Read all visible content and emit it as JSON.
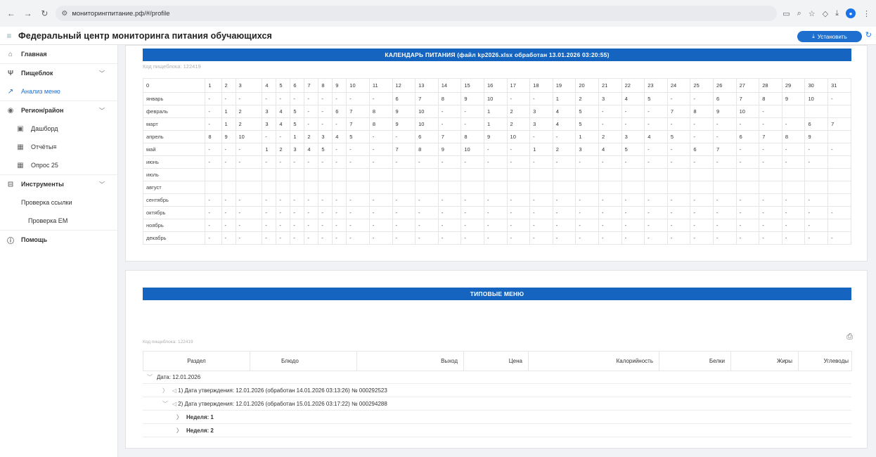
{
  "browser": {
    "url": "мониторингпитание.рф/#/profile"
  },
  "app": {
    "title": "Федеральный центр мониторинга питания обучающихся",
    "install_label": "Установить"
  },
  "sidebar": {
    "items": [
      {
        "label": "Главная",
        "icon": "home-icon"
      },
      {
        "label": "Пищеблок",
        "icon": "fork-knife-icon"
      },
      {
        "label": "Анализ меню",
        "icon": "chart-icon"
      },
      {
        "label": "Регион/район",
        "icon": "eye-icon"
      },
      {
        "label": "Дашборд",
        "icon": "dashboard-icon"
      },
      {
        "label": "Отчёты≡",
        "icon": "table-icon"
      },
      {
        "label": "Опрос 25",
        "icon": "table-icon"
      },
      {
        "label": "Инструменты",
        "icon": "toolbox-icon"
      },
      {
        "label": "Проверка ссылки"
      },
      {
        "label": "Проверка ЕМ"
      },
      {
        "label": "Помощь",
        "icon": "help-icon"
      }
    ]
  },
  "calendar": {
    "title": "КАЛЕНДАРЬ ПИТАНИЯ (файл kp2026.xlsx обработан 13.01.2026 03:20:55)",
    "code_label": "Код пищеблока: 122419",
    "header": [
      "0",
      "1",
      "2",
      "3",
      "4",
      "5",
      "6",
      "7",
      "8",
      "9",
      "10",
      "11",
      "12",
      "13",
      "14",
      "15",
      "16",
      "17",
      "18",
      "19",
      "20",
      "21",
      "22",
      "23",
      "24",
      "25",
      "26",
      "27",
      "28",
      "29",
      "30",
      "31"
    ],
    "rows": [
      [
        "январь",
        "-",
        "-",
        "-",
        "-",
        "-",
        "-",
        "-",
        "-",
        "-",
        "-",
        "-",
        "6",
        "7",
        "8",
        "9",
        "10",
        "-",
        "-",
        "1",
        "2",
        "3",
        "4",
        "5",
        "-",
        "-",
        "6",
        "7",
        "8",
        "9",
        "10",
        "-"
      ],
      [
        "февраль",
        "-",
        "1",
        "2",
        "3",
        "4",
        "5",
        "-",
        "-",
        "6",
        "7",
        "8",
        "9",
        "10",
        "-",
        "-",
        "1",
        "2",
        "3",
        "4",
        "5",
        "-",
        "-",
        "-",
        "7",
        "8",
        "9",
        "10",
        "-",
        "",
        "",
        ""
      ],
      [
        "март",
        "-",
        "1",
        "2",
        "3",
        "4",
        "5",
        "-",
        "-",
        "-",
        "7",
        "8",
        "9",
        "10",
        "-",
        "-",
        "1",
        "2",
        "3",
        "4",
        "5",
        "-",
        "-",
        "-",
        "-",
        "-",
        "-",
        "-",
        "-",
        "-",
        "6",
        "7"
      ],
      [
        "апрель",
        "8",
        "9",
        "10",
        "-",
        "-",
        "1",
        "2",
        "3",
        "4",
        "5",
        "-",
        "-",
        "6",
        "7",
        "8",
        "9",
        "10",
        "-",
        "-",
        "1",
        "2",
        "3",
        "4",
        "5",
        "-",
        "-",
        "6",
        "7",
        "8",
        "9",
        ""
      ],
      [
        "май",
        "-",
        "-",
        "-",
        "1",
        "2",
        "3",
        "4",
        "5",
        "-",
        "-",
        "-",
        "7",
        "8",
        "9",
        "10",
        "-",
        "-",
        "1",
        "2",
        "3",
        "4",
        "5",
        "-",
        "-",
        "6",
        "7",
        "-",
        "-",
        "-",
        "-",
        "-"
      ],
      [
        "июнь",
        "-",
        "-",
        "-",
        "-",
        "-",
        "-",
        "-",
        "-",
        "-",
        "-",
        "-",
        "-",
        "-",
        "-",
        "-",
        "-",
        "-",
        "-",
        "-",
        "-",
        "-",
        "-",
        "-",
        "-",
        "-",
        "-",
        "-",
        "-",
        "-",
        "-",
        ""
      ],
      [
        "июль",
        "",
        "",
        "",
        "",
        "",
        "",
        "",
        "",
        "",
        "",
        "",
        "",
        "",
        "",
        "",
        "",
        "",
        "",
        "",
        "",
        "",
        "",
        "",
        "",
        "",
        "",
        "",
        "",
        "",
        "",
        ""
      ],
      [
        "август",
        "",
        "",
        "",
        "",
        "",
        "",
        "",
        "",
        "",
        "",
        "",
        "",
        "",
        "",
        "",
        "",
        "",
        "",
        "",
        "",
        "",
        "",
        "",
        "",
        "",
        "",
        "",
        "",
        "",
        "",
        ""
      ],
      [
        "сентябрь",
        "-",
        "-",
        "-",
        "-",
        "-",
        "-",
        "-",
        "-",
        "-",
        "-",
        "-",
        "-",
        "-",
        "-",
        "-",
        "-",
        "-",
        "-",
        "-",
        "-",
        "-",
        "-",
        "-",
        "-",
        "-",
        "-",
        "-",
        "-",
        "-",
        "-",
        ""
      ],
      [
        "октябрь",
        "-",
        "-",
        "-",
        "-",
        "-",
        "-",
        "-",
        "-",
        "-",
        "-",
        "-",
        "-",
        "-",
        "-",
        "-",
        "-",
        "-",
        "-",
        "-",
        "-",
        "-",
        "-",
        "-",
        "-",
        "-",
        "-",
        "-",
        "-",
        "-",
        "-",
        "-"
      ],
      [
        "ноябрь",
        "-",
        "-",
        "-",
        "-",
        "-",
        "-",
        "-",
        "-",
        "-",
        "-",
        "-",
        "-",
        "-",
        "-",
        "-",
        "-",
        "-",
        "-",
        "-",
        "-",
        "-",
        "-",
        "-",
        "-",
        "-",
        "-",
        "-",
        "-",
        "-",
        "-",
        ""
      ],
      [
        "декабрь",
        "-",
        "-",
        "-",
        "-",
        "-",
        "-",
        "-",
        "-",
        "-",
        "-",
        "-",
        "-",
        "-",
        "-",
        "-",
        "-",
        "-",
        "-",
        "-",
        "-",
        "-",
        "-",
        "-",
        "-",
        "-",
        "-",
        "-",
        "-",
        "-",
        "-",
        "-"
      ]
    ]
  },
  "menus": {
    "title": "ТИПОВЫЕ МЕНЮ",
    "code_label": "Код пищеблока: 122419",
    "columns": [
      "Раздел",
      "Блюдо",
      "Выход",
      "Цена",
      "Калорийность",
      "Белки",
      "Жиры",
      "Углеводы"
    ],
    "tree": [
      {
        "level": 0,
        "arrow": "﹀",
        "tag": "",
        "text": "Дата: 12.01.2026"
      },
      {
        "level": 1,
        "arrow": "〉",
        "tag": "◁",
        "text": "1) Дата утверждения: 12.01.2026 (обработан 14.01.2026 03:13:26) № 000292523"
      },
      {
        "level": 1,
        "arrow": "﹀",
        "tag": "◁",
        "text": "2) Дата утверждения: 12.01.2026 (обработан 15.01.2026 03:17:22) № 000294288"
      },
      {
        "level": 2,
        "arrow": "〉",
        "tag": "",
        "text": "Неделя: 1"
      },
      {
        "level": 2,
        "arrow": "〉",
        "tag": "",
        "text": "Неделя: 2"
      }
    ]
  }
}
